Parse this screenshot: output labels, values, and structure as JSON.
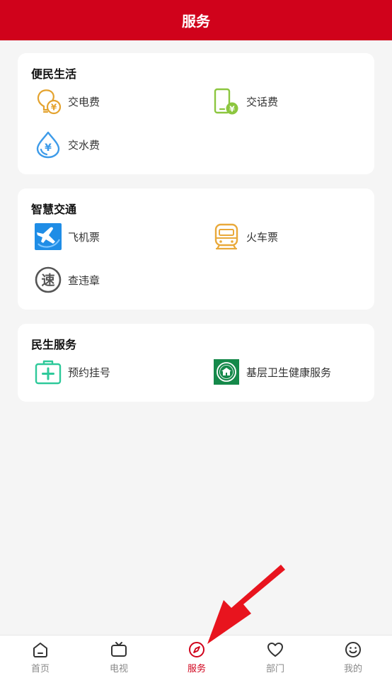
{
  "header": {
    "title": "服务"
  },
  "sections": [
    {
      "title": "便民生活",
      "items": [
        {
          "label": "交电费",
          "icon": "electricity-bill-icon"
        },
        {
          "label": "交话费",
          "icon": "phone-bill-icon"
        },
        {
          "label": "交水费",
          "icon": "water-bill-icon"
        }
      ]
    },
    {
      "title": "智慧交通",
      "items": [
        {
          "label": "飞机票",
          "icon": "plane-ticket-icon"
        },
        {
          "label": "火车票",
          "icon": "train-ticket-icon"
        },
        {
          "label": "查违章",
          "icon": "traffic-violation-icon"
        }
      ]
    },
    {
      "title": "民生服务",
      "items": [
        {
          "label": "预约挂号",
          "icon": "medical-appointment-icon"
        },
        {
          "label": "基层卫生健康服务",
          "icon": "health-service-icon"
        }
      ]
    }
  ],
  "icon_glyphs": {
    "currency": "¥",
    "speed": "速"
  },
  "tabs": [
    {
      "label": "首页",
      "icon": "home-icon",
      "active": false
    },
    {
      "label": "电视",
      "icon": "tv-icon",
      "active": false
    },
    {
      "label": "服务",
      "icon": "compass-icon",
      "active": true
    },
    {
      "label": "部门",
      "icon": "heart-icon",
      "active": false
    },
    {
      "label": "我的",
      "icon": "smiley-icon",
      "active": false
    }
  ],
  "colors": {
    "brand_red": "#d0021b",
    "page_bg": "#f5f5f5",
    "inactive_tab": "#8a8a8a",
    "annotation_arrow": "#e8141e"
  }
}
